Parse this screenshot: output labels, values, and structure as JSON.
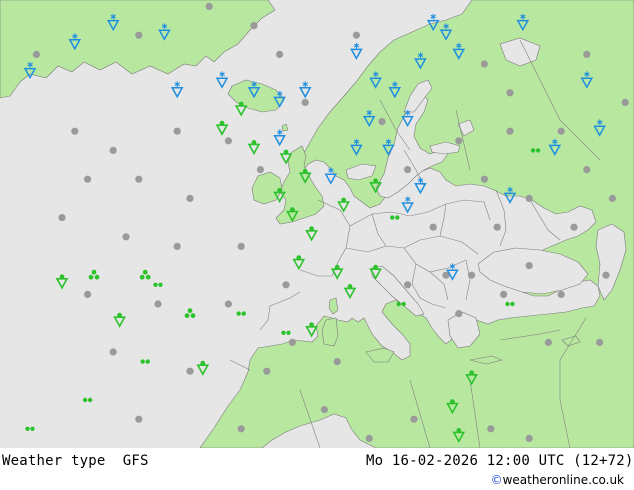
{
  "map": {
    "colors": {
      "sea": "#e6e6e6",
      "land": "#b8e8a0",
      "border": "#808080",
      "coast": "#7a7a7a",
      "rain": "#2cc22c",
      "snow": "#1e8fe0",
      "cloud": "#9a9a9a"
    },
    "symbols": [
      {
        "k": "cloud",
        "lon": -38,
        "lat": 62
      },
      {
        "k": "cloud",
        "lon": -32,
        "lat": 60
      },
      {
        "k": "cloud",
        "lon": -22,
        "lat": 62
      },
      {
        "k": "cloud",
        "lon": -14,
        "lat": 61
      },
      {
        "k": "cloud",
        "lon": -36,
        "lat": 57
      },
      {
        "k": "cloud",
        "lon": -28,
        "lat": 57
      },
      {
        "k": "cloud",
        "lon": -20,
        "lat": 55
      },
      {
        "k": "cloud",
        "lon": -9,
        "lat": 58
      },
      {
        "k": "cloud",
        "lon": -40,
        "lat": 53
      },
      {
        "k": "cloud",
        "lon": -30,
        "lat": 51
      },
      {
        "k": "cloud",
        "lon": -22,
        "lat": 50
      },
      {
        "k": "cloud",
        "lon": -12,
        "lat": 50
      },
      {
        "k": "cloud",
        "lon": -36,
        "lat": 45
      },
      {
        "k": "cloud",
        "lon": -25,
        "lat": 44
      },
      {
        "k": "cloud",
        "lon": -14,
        "lat": 44
      },
      {
        "k": "cloud",
        "lon": -5,
        "lat": 46
      },
      {
        "k": "cloud",
        "lon": -32,
        "lat": 39
      },
      {
        "k": "cloud",
        "lon": -20,
        "lat": 37
      },
      {
        "k": "cloud",
        "lon": -8,
        "lat": 37
      },
      {
        "k": "cloud",
        "lon": -28,
        "lat": 32
      },
      {
        "k": "cloud",
        "lon": -12,
        "lat": 31
      },
      {
        "k": "cloud",
        "lon": 3,
        "lat": 38
      },
      {
        "k": "cloud",
        "lon": 1,
        "lat": 33
      },
      {
        "k": "cloud",
        "lon": 8,
        "lat": 30
      },
      {
        "k": "cloud",
        "lon": 15,
        "lat": 32
      },
      {
        "k": "cloud",
        "lon": 20,
        "lat": 29
      },
      {
        "k": "cloud",
        "lon": 27,
        "lat": 31
      },
      {
        "k": "cloud",
        "lon": 33,
        "lat": 30
      },
      {
        "k": "cloud",
        "lon": 22,
        "lat": 43
      },
      {
        "k": "cloud",
        "lon": 24,
        "lat": 47
      },
      {
        "k": "cloud",
        "lon": 29,
        "lat": 45
      },
      {
        "k": "cloud",
        "lon": 33,
        "lat": 48
      },
      {
        "k": "cloud",
        "lon": 38,
        "lat": 45
      },
      {
        "k": "cloud",
        "lon": 40,
        "lat": 52
      },
      {
        "k": "cloud",
        "lon": 45,
        "lat": 47
      },
      {
        "k": "cloud",
        "lon": 46,
        "lat": 55
      },
      {
        "k": "cloud",
        "lon": 33,
        "lat": 55
      },
      {
        "k": "cloud",
        "lon": 28,
        "lat": 52
      },
      {
        "k": "cloud",
        "lon": 26,
        "lat": 57
      },
      {
        "k": "cloud",
        "lon": 38,
        "lat": 62
      },
      {
        "k": "cloud",
        "lon": 48,
        "lat": 65
      },
      {
        "k": "cloud",
        "lon": 30,
        "lat": 66
      },
      {
        "k": "cloud",
        "lon": 42,
        "lat": 70
      },
      {
        "k": "cloud",
        "lon": 26,
        "lat": 69
      },
      {
        "k": "cloud",
        "lon": 14,
        "lat": 58
      },
      {
        "k": "cloud",
        "lon": 18,
        "lat": 52
      },
      {
        "k": "cloud",
        "lon": 14,
        "lat": 46
      },
      {
        "k": "cloud",
        "lon": 20,
        "lat": 47
      },
      {
        "k": "cloud",
        "lon": -2,
        "lat": 65
      },
      {
        "k": "cloud",
        "lon": -6,
        "lat": 70
      },
      {
        "k": "cloud",
        "lon": -10,
        "lat": 73
      },
      {
        "k": "cloud",
        "lon": 6,
        "lat": 72
      },
      {
        "k": "cloud",
        "lon": -17,
        "lat": 75
      },
      {
        "k": "cloud",
        "lon": -28,
        "lat": 72
      },
      {
        "k": "cloud",
        "lon": -44,
        "lat": 70
      },
      {
        "k": "cloud",
        "lon": -34,
        "lat": 76
      },
      {
        "k": "cloud",
        "lon": 50,
        "lat": 60
      },
      {
        "k": "cloud",
        "lon": 42,
        "lat": 58
      },
      {
        "k": "cloud",
        "lon": 36,
        "lat": 40
      },
      {
        "k": "cloud",
        "lon": 44,
        "lat": 40
      },
      {
        "k": "cloud",
        "lon": 10,
        "lat": 63
      },
      {
        "k": "cloud",
        "lon": 22,
        "lat": 61
      },
      {
        "k": "cloud",
        "lon": 30,
        "lat": 62
      },
      {
        "k": "cloud",
        "lon": -4,
        "lat": 40
      },
      {
        "k": "rain",
        "lon": -40,
        "lat": 46
      },
      {
        "k": "rain",
        "lon": -31,
        "lat": 42
      },
      {
        "k": "rain",
        "lon": -18,
        "lat": 37
      },
      {
        "k": "rain",
        "lon": -10,
        "lat": 60
      },
      {
        "k": "rain",
        "lon": -15,
        "lat": 62
      },
      {
        "k": "rain",
        "lon": -5,
        "lat": 59
      },
      {
        "k": "rain",
        "lon": -2,
        "lat": 57
      },
      {
        "k": "rain",
        "lon": -4,
        "lat": 53
      },
      {
        "k": "rain",
        "lon": -6,
        "lat": 55
      },
      {
        "k": "rain",
        "lon": -1,
        "lat": 51
      },
      {
        "k": "rain",
        "lon": -3,
        "lat": 48
      },
      {
        "k": "rain",
        "lon": 3,
        "lat": 47
      },
      {
        "k": "rain",
        "lon": 5,
        "lat": 45
      },
      {
        "k": "rain",
        "lon": 9,
        "lat": 47
      },
      {
        "k": "rain",
        "lon": 9,
        "lat": 56
      },
      {
        "k": "rain",
        "lon": 4,
        "lat": 54
      },
      {
        "k": "rain",
        "lon": 24,
        "lat": 36
      },
      {
        "k": "rain",
        "lon": 21,
        "lat": 33
      },
      {
        "k": "rain",
        "lon": 22,
        "lat": 30
      },
      {
        "k": "rain",
        "lon": -1,
        "lat": 41
      },
      {
        "k": "rain",
        "lon": -12,
        "lat": 64
      },
      {
        "k": "drizzle",
        "lon": -25,
        "lat": 46
      },
      {
        "k": "drizzle",
        "lon": -27,
        "lat": 38
      },
      {
        "k": "drizzle",
        "lon": -36,
        "lat": 34
      },
      {
        "k": "drizzle",
        "lon": -45,
        "lat": 31
      },
      {
        "k": "drizzle",
        "lon": 12,
        "lat": 53
      },
      {
        "k": "drizzle",
        "lon": 13,
        "lat": 44
      },
      {
        "k": "drizzle",
        "lon": 30,
        "lat": 44
      },
      {
        "k": "drizzle",
        "lon": 34,
        "lat": 60
      },
      {
        "k": "drizzle",
        "lon": -5,
        "lat": 41
      },
      {
        "k": "drizzle",
        "lon": -12,
        "lat": 43
      },
      {
        "k": "shower",
        "lon": -35,
        "lat": 47
      },
      {
        "k": "shower",
        "lon": -27,
        "lat": 47
      },
      {
        "k": "shower",
        "lon": -20,
        "lat": 43
      },
      {
        "k": "snow",
        "lon": -45,
        "lat": 68
      },
      {
        "k": "snow",
        "lon": -38,
        "lat": 71
      },
      {
        "k": "snow",
        "lon": -32,
        "lat": 73
      },
      {
        "k": "snow",
        "lon": -24,
        "lat": 72
      },
      {
        "k": "snow",
        "lon": -22,
        "lat": 66
      },
      {
        "k": "snow",
        "lon": -15,
        "lat": 67
      },
      {
        "k": "snow",
        "lon": -10,
        "lat": 66
      },
      {
        "k": "snow",
        "lon": -6,
        "lat": 65
      },
      {
        "k": "snow",
        "lon": -2,
        "lat": 66
      },
      {
        "k": "snow",
        "lon": 6,
        "lat": 70
      },
      {
        "k": "snow",
        "lon": 9,
        "lat": 67
      },
      {
        "k": "snow",
        "lon": 12,
        "lat": 66
      },
      {
        "k": "snow",
        "lon": 14,
        "lat": 63
      },
      {
        "k": "snow",
        "lon": 20,
        "lat": 72
      },
      {
        "k": "snow",
        "lon": 8,
        "lat": 63
      },
      {
        "k": "snow",
        "lon": 6,
        "lat": 60
      },
      {
        "k": "snow",
        "lon": 11,
        "lat": 60
      },
      {
        "k": "snow",
        "lon": 16,
        "lat": 56
      },
      {
        "k": "snow",
        "lon": 14,
        "lat": 54
      },
      {
        "k": "snow",
        "lon": 22,
        "lat": 70
      },
      {
        "k": "snow",
        "lon": 32,
        "lat": 73
      },
      {
        "k": "snow",
        "lon": 42,
        "lat": 67
      },
      {
        "k": "snow",
        "lon": 37,
        "lat": 60
      },
      {
        "k": "snow",
        "lon": 44,
        "lat": 62
      },
      {
        "k": "snow",
        "lon": 30,
        "lat": 55
      },
      {
        "k": "snow",
        "lon": 16,
        "lat": 69
      },
      {
        "k": "snow",
        "lon": -6,
        "lat": 61
      },
      {
        "k": "snow",
        "lon": 21,
        "lat": 47
      },
      {
        "k": "snow",
        "lon": 2,
        "lat": 57
      },
      {
        "k": "snow",
        "lon": 18,
        "lat": 73
      }
    ]
  },
  "footer": {
    "label": "Weather type  GFS",
    "datetime": "Mo 16-02-2026 12:00 UTC (12+72)",
    "credit_symbol": "©",
    "credit_text": "weatheronline.co.uk"
  }
}
